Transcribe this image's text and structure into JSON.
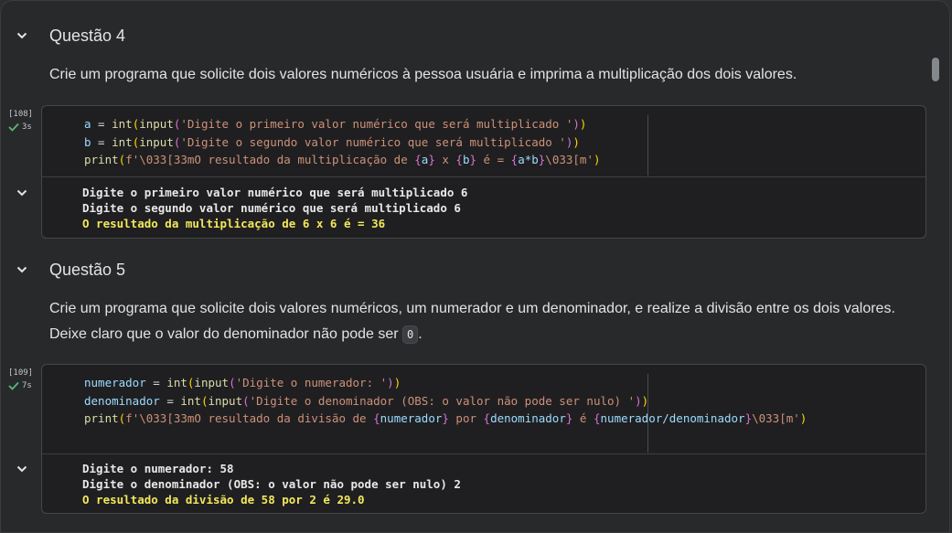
{
  "sections": [
    {
      "heading": "Questão 4",
      "description": "Crie um programa que solicite dois valores numéricos à pessoa usuária e imprima a multiplicação dos dois valores.",
      "cell": {
        "exec_count": "[108]",
        "exec_time": "3s",
        "code_lines": [
          "a = int(input('Digite o primeiro valor numérico que será multiplicado '))",
          "b = int(input('Digite o segundo valor numérico que será multiplicado '))",
          "print(f'\\033[33mO resultado da multiplicação de {a} x {b} é = {a*b}\\033[m')"
        ],
        "output_lines": [
          "Digite o primeiro valor numérico que será multiplicado 6",
          "Digite o segundo valor numérico que será multiplicado 6"
        ],
        "output_highlight": "O resultado da multiplicação de 6 x 6 é = 36"
      }
    },
    {
      "heading": "Questão 5",
      "description_line1": "Crie um programa que solicite dois valores numéricos, um numerador e um denominador, e realize a divisão entre os dois valores.",
      "description_line2_prefix": "Deixe claro que o valor do denominador não pode ser",
      "description_code": "0",
      "description_line2_suffix": ".",
      "cell": {
        "exec_count": "[109]",
        "exec_time": "7s",
        "code_lines": [
          "numerador = int(input('Digite o numerador: '))",
          "denominador = int(input('Digite o denominador (OBS: o valor não pode ser nulo) '))",
          "print(f'\\033[33mO resultado da divisão de {numerador} por {denominador} é {numerador/denominador}\\033[m')"
        ],
        "output_lines": [
          "Digite o numerador: 58",
          "Digite o denominador (OBS: o valor não pode ser nulo) 2"
        ],
        "output_highlight": "O resultado da divisão de 58 por 2 é 29.0"
      }
    }
  ],
  "colors": {
    "background": "#28292b",
    "cell_bg": "#1f1f21",
    "output_highlight": "#f2e85a",
    "success_check": "#5bb974"
  },
  "icons": {
    "collapse": "chevron-down-icon",
    "status": "check-icon"
  }
}
